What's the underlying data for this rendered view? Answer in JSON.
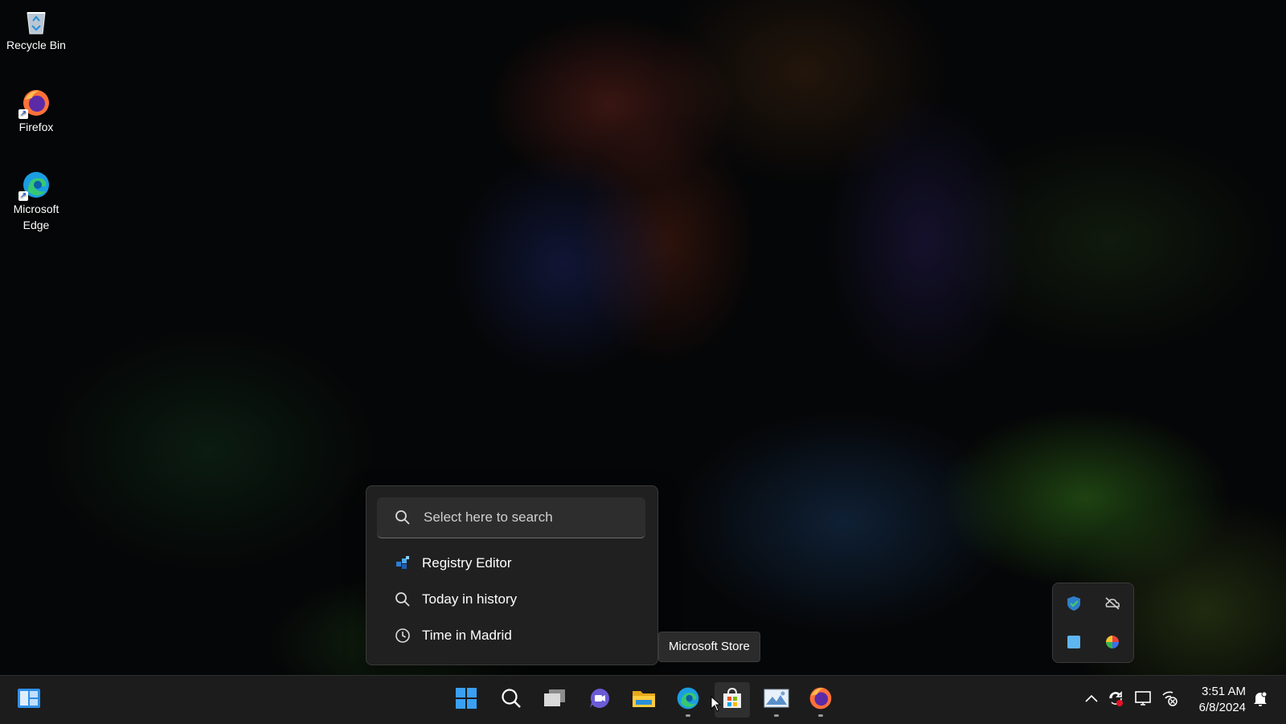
{
  "desktop": {
    "icons": [
      {
        "label": "Recycle Bin",
        "icon": "recycle-bin-icon"
      },
      {
        "label": "Firefox",
        "icon": "firefox-icon"
      },
      {
        "label": "Microsoft Edge",
        "icon": "edge-icon"
      }
    ]
  },
  "search_popup": {
    "placeholder": "Select here to search",
    "results": [
      {
        "label": "Registry Editor",
        "icon": "registry-editor-icon"
      },
      {
        "label": "Today in history",
        "icon": "search-icon"
      },
      {
        "label": "Time in Madrid",
        "icon": "clock-icon"
      }
    ]
  },
  "tooltip": {
    "text": "Microsoft Store"
  },
  "tray_flyout": {
    "icons": [
      "windows-security-icon",
      "onedrive-offline-icon",
      "blue-square-app-icon",
      "color-wheel-icon"
    ]
  },
  "taskbar": {
    "apps": [
      {
        "name": "Widgets",
        "icon": "widgets-icon"
      },
      {
        "name": "Start",
        "icon": "start-icon"
      },
      {
        "name": "Search",
        "icon": "search-icon"
      },
      {
        "name": "Task View",
        "icon": "task-view-icon"
      },
      {
        "name": "Chat",
        "icon": "chat-icon"
      },
      {
        "name": "File Explorer",
        "icon": "file-explorer-icon"
      },
      {
        "name": "Microsoft Edge",
        "icon": "edge-icon"
      },
      {
        "name": "Microsoft Store",
        "icon": "store-icon"
      },
      {
        "name": "Photos",
        "icon": "photos-icon"
      },
      {
        "name": "Firefox",
        "icon": "firefox-icon"
      }
    ],
    "tray": [
      "chevron-up-icon",
      "sync-error-icon",
      "display-icon",
      "network-icon"
    ],
    "clock": {
      "time": "3:51 AM",
      "date": "6/8/2024"
    },
    "notification_icon": "notification-icon"
  },
  "colors": {
    "taskbar": "#1c1c1c",
    "popup": "#202020",
    "accent": "#0078d4"
  }
}
